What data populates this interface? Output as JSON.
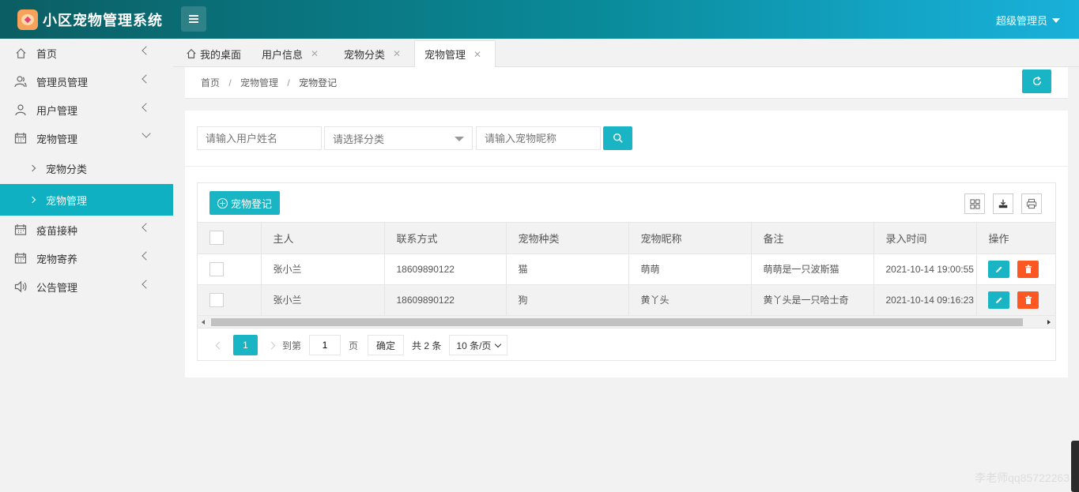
{
  "header": {
    "title": "小区宠物管理系统",
    "user": "超级管理员"
  },
  "sidebar": {
    "items": [
      {
        "label": "首页"
      },
      {
        "label": "管理员管理"
      },
      {
        "label": "用户管理"
      },
      {
        "label": "宠物管理"
      },
      {
        "label": "疫苗接种"
      },
      {
        "label": "宠物寄养"
      },
      {
        "label": "公告管理"
      }
    ],
    "subitems": [
      {
        "label": "宠物分类"
      },
      {
        "label": "宠物管理"
      }
    ]
  },
  "tabs": [
    {
      "label": "我的桌面"
    },
    {
      "label": "用户信息"
    },
    {
      "label": "宠物分类"
    },
    {
      "label": "宠物管理"
    }
  ],
  "breadcrumb": {
    "home": "首页",
    "sep": "/",
    "parent": "宠物管理",
    "current": "宠物登记"
  },
  "search": {
    "user_placeholder": "请输入用户姓名",
    "category_placeholder": "请选择分类",
    "nickname_placeholder": "请输入宠物昵称"
  },
  "toolbar": {
    "add_label": "宠物登记"
  },
  "table": {
    "columns": [
      "主人",
      "联系方式",
      "宠物种类",
      "宠物昵称",
      "备注",
      "录入时间",
      "操作"
    ],
    "rows": [
      {
        "owner": "张小兰",
        "phone": "18609890122",
        "type": "猫",
        "nickname": "萌萌",
        "note": "萌萌是一只波斯猫",
        "time": "2021-10-14 19:00:55"
      },
      {
        "owner": "张小兰",
        "phone": "18609890122",
        "type": "狗",
        "nickname": "黄丫头",
        "note": "黄丫头是一只哈士奇",
        "time": "2021-10-14 09:16:23"
      }
    ]
  },
  "pager": {
    "current": "1",
    "goto_label": "到第",
    "page_value": "1",
    "page_unit": "页",
    "confirm": "确定",
    "total": "共 2 条",
    "page_size": "10 条/页"
  },
  "watermark": "李老师qq85722263",
  "colors": {
    "accent": "#1ab5c4",
    "danger": "#ff5722",
    "header_start": "#0b5e63",
    "header_end": "#19b0d9"
  }
}
